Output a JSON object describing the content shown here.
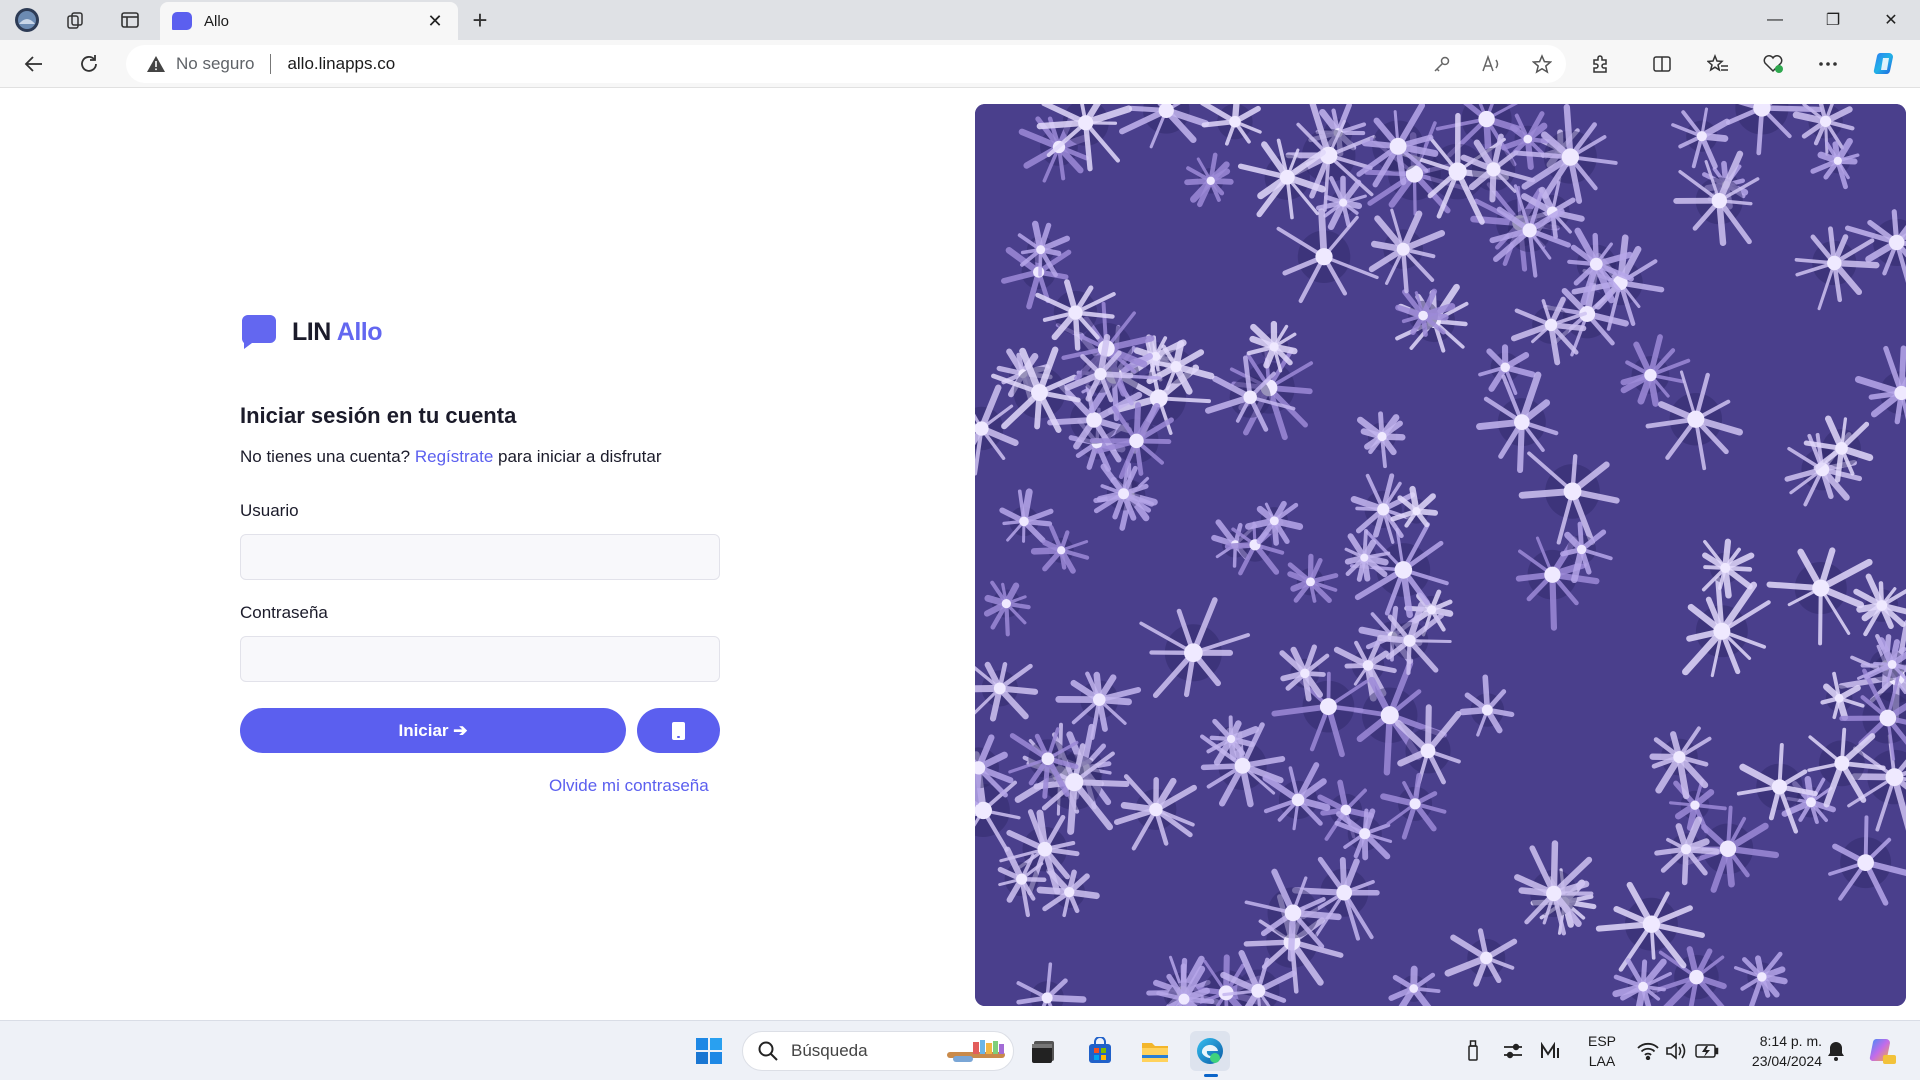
{
  "browser": {
    "tab": {
      "title": "Allo",
      "close": "✕"
    },
    "new_tab": "+",
    "window_controls": {
      "minimize": "—",
      "maximize": "❐",
      "close": "✕"
    },
    "address": {
      "security_label": "No seguro",
      "url": "allo.linapps.co"
    },
    "icons": [
      "profile-icon",
      "collections-icon",
      "tab-actions-icon",
      "back-icon",
      "refresh-icon",
      "warning-icon",
      "key-icon",
      "read-aloud-icon",
      "favorite-star-icon",
      "extensions-icon",
      "split-screen-icon",
      "favorites-icon",
      "browser-essentials-icon",
      "more-icon",
      "copilot-icon"
    ]
  },
  "page": {
    "logo": {
      "part1": "LIN",
      "part2": "Allo"
    },
    "heading": "Iniciar sesión en tu cuenta",
    "subline": {
      "before": "No tienes una cuenta? ",
      "link": "Regístrate",
      "after": " para iniciar a disfrutar"
    },
    "username_label": "Usuario",
    "username_value": "",
    "password_label": "Contraseña",
    "password_value": "",
    "login_button": "Iniciar ➔",
    "forgot_link": "Olvide mi contraseña",
    "accent_color": "#5b5fef"
  },
  "taskbar": {
    "search_placeholder": "Búsqueda",
    "language": {
      "line1": "ESP",
      "line2": "LAA"
    },
    "clock": {
      "time": "8:14 p. m.",
      "date": "23/04/2024"
    },
    "icons": [
      "start-icon",
      "search-icon",
      "terminal-icon",
      "store-icon",
      "file-explorer-icon",
      "edge-icon",
      "usb-icon",
      "settings-sliders-icon",
      "media-icon",
      "wifi-icon",
      "volume-icon",
      "battery-icon",
      "notification-bell-icon",
      "copilot-icon"
    ]
  }
}
